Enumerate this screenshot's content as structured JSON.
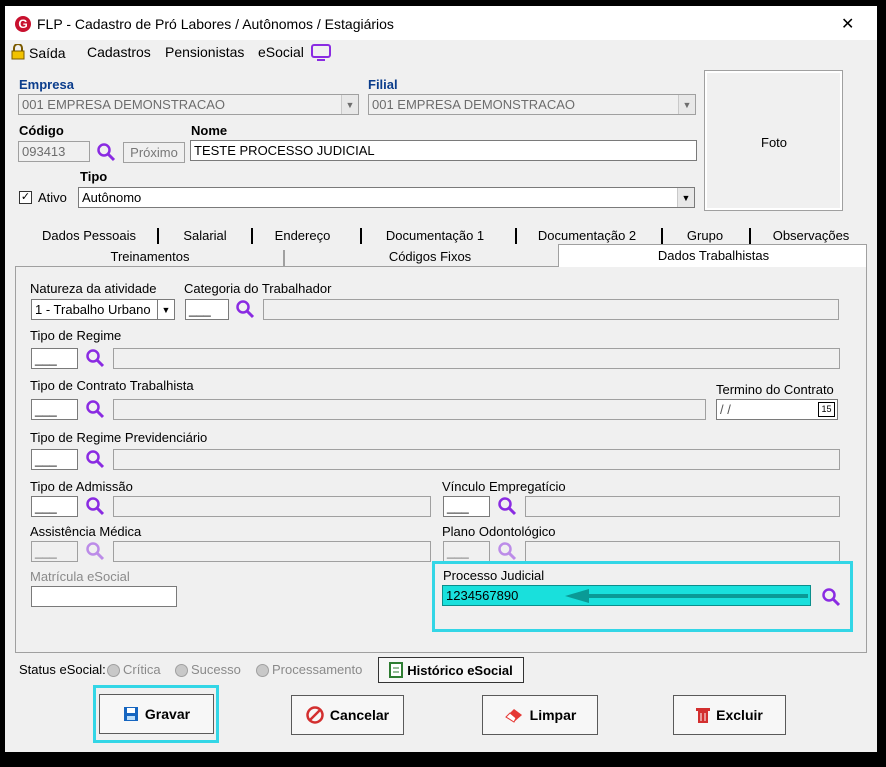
{
  "window": {
    "title": "FLP - Cadastro de Pró Labores / Autônomos / Estagiários",
    "close": "✕"
  },
  "menu": {
    "saida": "Saída",
    "cadastros": "Cadastros",
    "pensionistas": "Pensionistas",
    "esocial": "eSocial"
  },
  "header": {
    "empresa_label": "Empresa",
    "empresa_value": "001 EMPRESA DEMONSTRACAO",
    "filial_label": "Filial",
    "filial_value": "001 EMPRESA DEMONSTRACAO",
    "codigo_label": "Código",
    "codigo_value": "093413",
    "proximo_label": "Próximo",
    "nome_label": "Nome",
    "nome_value": "TESTE PROCESSO JUDICIAL",
    "tipo_label": "Tipo",
    "tipo_value": "Autônomo",
    "ativo_label": "Ativo",
    "foto_label": "Foto"
  },
  "tabs_row1": [
    "Dados Pessoais",
    "Salarial",
    "Endereço",
    "Documentação 1",
    "Documentação 2",
    "Grupo",
    "Observações"
  ],
  "tabs_row2": [
    "Treinamentos",
    "Códigos Fixos",
    "Dados Trabalhistas"
  ],
  "form": {
    "natureza_label": "Natureza da atividade",
    "natureza_value": "1 - Trabalho Urbano",
    "categoria_label": "Categoria do Trabalhador",
    "blank_code": "___",
    "regime_label": "Tipo de Regime",
    "contrato_label": "Tipo de Contrato Trabalhista",
    "termino_label": "Termino do Contrato",
    "termino_value": " / /",
    "calendar": "15",
    "previdenciario_label": "Tipo de Regime Previdenciário",
    "admissao_label": "Tipo de Admissão",
    "vinculo_label": "Vínculo Empregatício",
    "assistencia_label": "Assistência Médica",
    "odontologico_label": "Plano Odontológico",
    "matricula_label": "Matrícula eSocial",
    "processo_label": "Processo Judicial",
    "processo_value": "1234567890"
  },
  "status": {
    "label": "Status eSocial:",
    "critica": "Crítica",
    "sucesso": "Sucesso",
    "processamento": "Processamento",
    "historico": "Histórico eSocial"
  },
  "buttons": {
    "gravar": "Gravar",
    "cancelar": "Cancelar",
    "limpar": "Limpar",
    "excluir": "Excluir"
  },
  "colors": {
    "accent": "#33d6e6",
    "title_red": "#c8102e",
    "label_blue": "#0b3d8c",
    "search_purple": "#8a2be2"
  }
}
